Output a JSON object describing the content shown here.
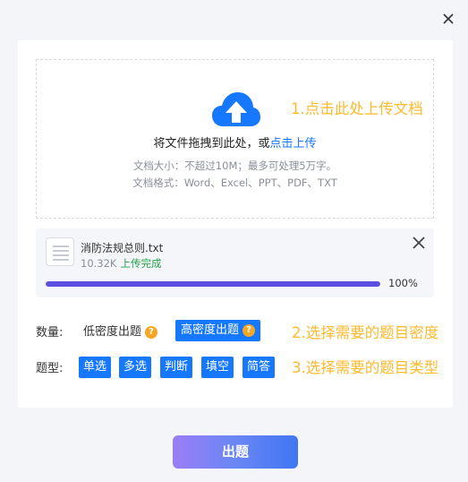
{
  "dialog": {
    "close_icon": "close-icon"
  },
  "upload": {
    "icon": "cloud-upload-icon",
    "prompt_prefix": "将文件拖拽到此处，或",
    "prompt_link": "点击上传",
    "hint_size": "文档大小：不超过10M；最多可处理5万字。",
    "hint_format": "文档格式：Word、Excel、PPT、PDF、TXT",
    "annotation": "1.点击此处上传文档"
  },
  "file": {
    "name": "消防法规总则.txt",
    "size": "10.32K",
    "status": "上传完成",
    "progress": 1.0,
    "progress_label": "100%",
    "remove_icon": "close-icon"
  },
  "density": {
    "label": "数量:",
    "options": [
      {
        "label": "低密度出题",
        "selected": false
      },
      {
        "label": "高密度出题",
        "selected": true
      }
    ],
    "help_glyph": "?",
    "annotation": "2.选择需要的题目密度"
  },
  "types": {
    "label": "题型:",
    "options": [
      "单选",
      "多选",
      "判断",
      "填空",
      "简答"
    ],
    "annotation": "3.选择需要的题目类型"
  },
  "submit": {
    "label": "出题"
  },
  "colors": {
    "accent": "#1677ff",
    "annotation": "#ffb92c",
    "progress": "#5b4fe0",
    "success": "#22a34a",
    "help_badge": "#f5a623"
  }
}
